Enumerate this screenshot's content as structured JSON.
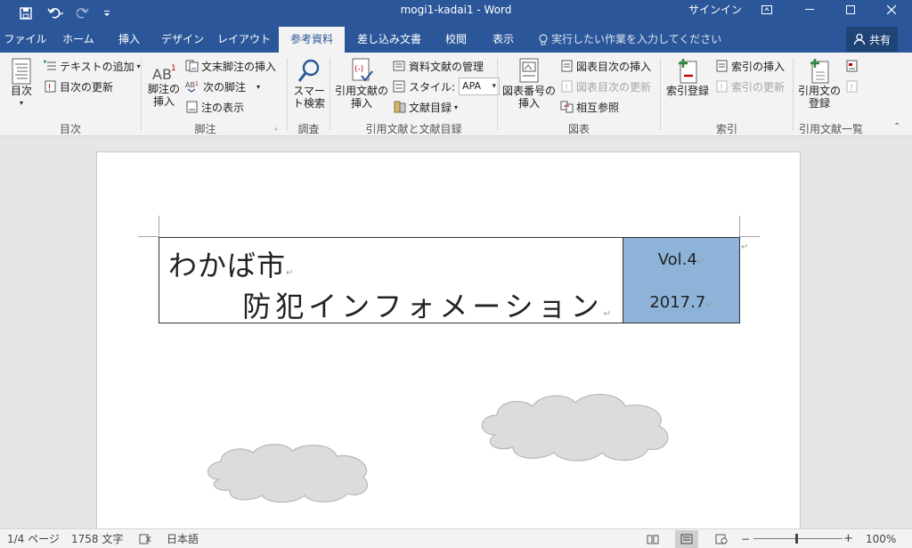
{
  "window": {
    "title": "mogi1-kadai1  -  Word",
    "signin": "サインイン",
    "share": "共有"
  },
  "tabs": [
    {
      "label": "ファイル"
    },
    {
      "label": "ホーム"
    },
    {
      "label": "挿入"
    },
    {
      "label": "デザイン"
    },
    {
      "label": "レイアウト"
    },
    {
      "label": "参考資料",
      "active": true
    },
    {
      "label": "差し込み文書"
    },
    {
      "label": "校閲"
    },
    {
      "label": "表示"
    }
  ],
  "tellme": "実行したい作業を入力してください",
  "ribbon": {
    "toc": {
      "big": "目次",
      "add_text": "テキストの追加",
      "update": "目次の更新",
      "group": "目次"
    },
    "footnotes": {
      "insert": "脚注の\n挿入",
      "insert_endnote": "文末脚注の挿入",
      "next": "次の脚注",
      "show": "注の表示",
      "group": "脚注"
    },
    "research": {
      "smart": "スマー\nト検索",
      "group": "調査"
    },
    "citations": {
      "insert": "引用文献の\n挿入",
      "manage": "資料文献の管理",
      "style_label": "スタイル:",
      "style_value": "APA",
      "bibliography": "文献目録",
      "group": "引用文献と文献目録"
    },
    "captions": {
      "insert": "図表番号の\n挿入",
      "insert_tof": "図表目次の挿入",
      "update_tof": "図表目次の更新",
      "cross_ref": "相互参照",
      "group": "図表"
    },
    "index": {
      "mark": "索引登録",
      "insert": "索引の挿入",
      "update": "索引の更新",
      "group": "索引"
    },
    "toa": {
      "mark": "引用文の\n登録",
      "group": "引用文献一覧"
    }
  },
  "document": {
    "title_line1": "わかば市",
    "title_line2": "防犯インフォメーション",
    "vol": "Vol.4",
    "date": "2017.7",
    "para_mark": "↵"
  },
  "status": {
    "page": "1/4 ページ",
    "words": "1758 文字",
    "language": "日本語",
    "zoom": "100%"
  },
  "colors": {
    "accent": "#2b579a",
    "header_cell": "#8db3d9"
  }
}
